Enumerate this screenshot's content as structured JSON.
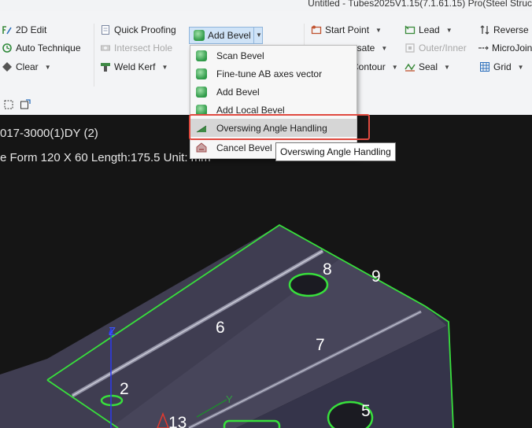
{
  "window": {
    "title": "Untitled - Tubes2025V1.15(7.1.61.15)  Pro(Steel Struc"
  },
  "ribbon": {
    "col1": [
      "2D Edit",
      "Auto Technique",
      "Clear"
    ],
    "col2": [
      "Quick Proofing",
      "Intersect Hole",
      "Weld Kerf"
    ],
    "add_bevel": "Add Bevel",
    "col4": [
      "Start Point",
      "nsate",
      "Contour"
    ],
    "col5": [
      "Lead",
      "Outer/Inner",
      "Seal"
    ],
    "col6": [
      "Reverse",
      "MicroJoint",
      "Grid"
    ]
  },
  "menu": {
    "items": [
      "Scan Bevel",
      "Fine-tune AB axes vector",
      "Add Bevel",
      "Add Local Bevel",
      "Overswing Angle Handling",
      "Cancel Bevel"
    ],
    "highlighted": "Overswing Angle Handling"
  },
  "tooltip": {
    "text": "Overswing Angle Handling"
  },
  "viewport": {
    "part_line1": "017-3000(1)DY (2)",
    "part_line2": "e Form 120 X 60 Length:175.5 Unit: mm",
    "labels": {
      "l2": "2",
      "l5": "5",
      "l6": "6",
      "l7": "7",
      "l8": "8",
      "l9": "9",
      "l13": "13",
      "axis_z": "Z",
      "axis_y": "Y"
    }
  },
  "colors": {
    "highlight_box": "#e04a3f",
    "edge": "#38e03c",
    "selected_button": "#cfe3f7",
    "part_face": "#3c3b4e"
  }
}
